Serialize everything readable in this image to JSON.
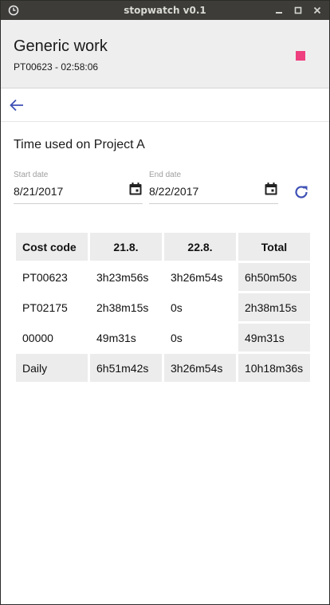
{
  "window": {
    "title": "stopwatch v0.1"
  },
  "header": {
    "task_title": "Generic work",
    "task_sub": "PT00623 - 02:58:06"
  },
  "report": {
    "title": "Time used on Project A",
    "start_label": "Start date",
    "start_value": "8/21/2017",
    "end_label": "End date",
    "end_value": "8/22/2017"
  },
  "table": {
    "headers": [
      "Cost code",
      "21.8.",
      "22.8.",
      "Total"
    ],
    "rows": [
      [
        "PT00623",
        "3h23m56s",
        "3h26m54s",
        "6h50m50s"
      ],
      [
        "PT02175",
        "2h38m15s",
        "0s",
        "2h38m15s"
      ],
      [
        "00000",
        "49m31s",
        "0s",
        "49m31s"
      ]
    ],
    "daily": [
      "Daily",
      "6h51m42s",
      "3h26m54s",
      "10h18m36s"
    ]
  },
  "colors": {
    "accent": "#3f51b5",
    "stop": "#ee3f7f",
    "titlebar": "#3d3c38"
  },
  "icons": [
    "clock-icon",
    "minimize-icon",
    "maximize-icon",
    "close-icon",
    "stop-icon",
    "back-arrow-icon",
    "calendar-icon",
    "refresh-icon"
  ]
}
